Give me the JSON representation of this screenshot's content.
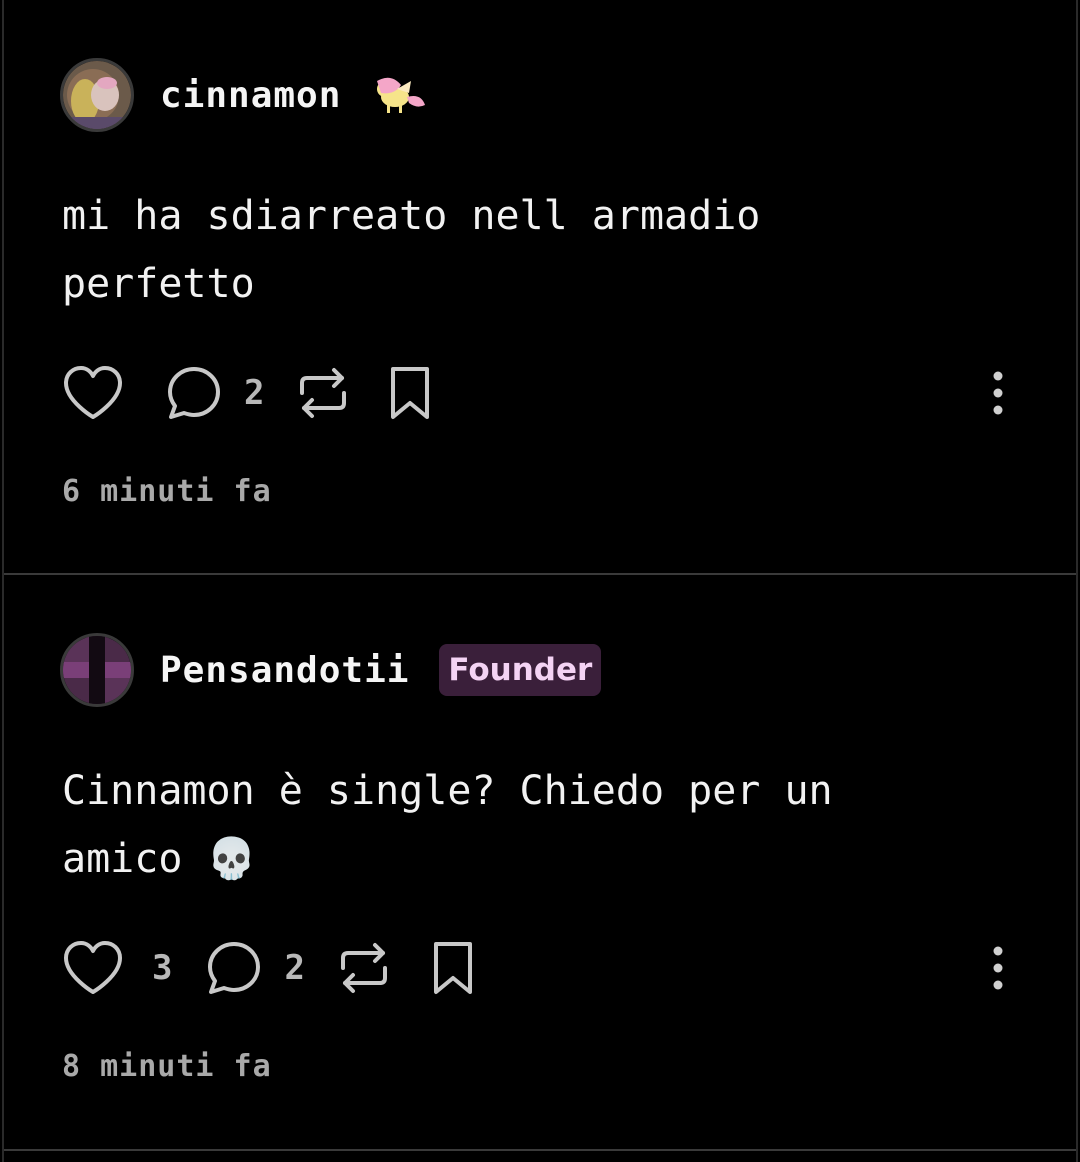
{
  "posts": [
    {
      "username": "cinnamon",
      "badge": "",
      "text_line1": "mi ha sdiarreato nell armadio",
      "text_line2": "perfetto",
      "likes": "",
      "comments": "2",
      "time": "6 minuti fa"
    },
    {
      "username": "Pensandotii",
      "badge": "Founder",
      "text_line1": "Cinnamon è single? Chiedo per un",
      "text_line2": "amico 💀",
      "likes": "3",
      "comments": "2",
      "time": "8 minuti fa"
    }
  ],
  "colors": {
    "badge_bg": "#3a1f3a",
    "badge_text": "#f4d3f4",
    "icon": "#c8c8c8",
    "divider": "#3a3a3a"
  },
  "icons": [
    "heart-icon",
    "comment-icon",
    "repost-icon",
    "bookmark-icon",
    "more-vertical-icon"
  ]
}
